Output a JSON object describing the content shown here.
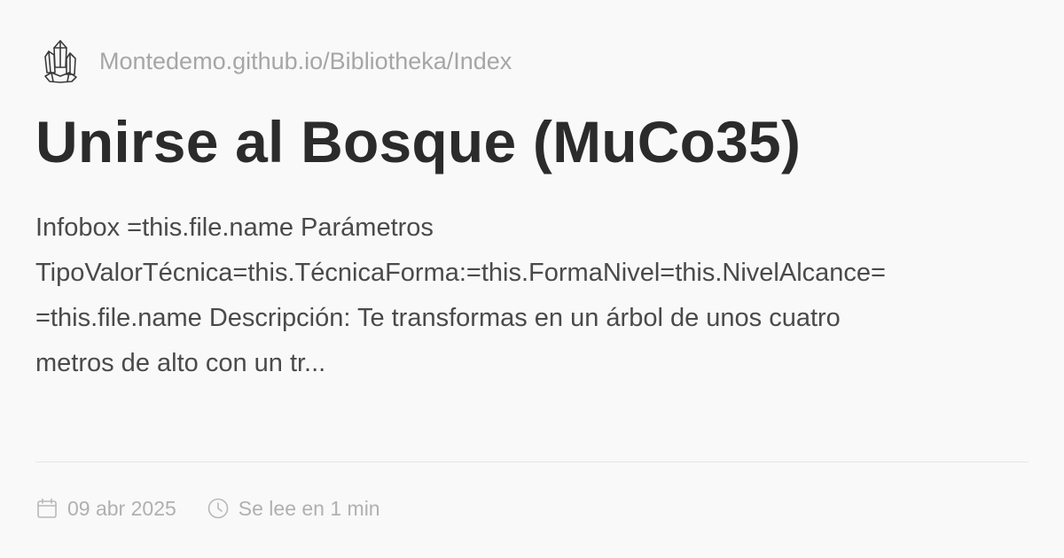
{
  "site": {
    "url": "Montedemo.github.io/Bibliotheka/Index",
    "logo_icon": "crystal-logo-icon"
  },
  "page": {
    "title": "Unirse al Bosque (MuCo35)",
    "description_lines": [
      "Infobox =this.file.name Parámetros",
      "TipoValorTécnica=this.TécnicaForma:=this.FormaNivel=this.NivelAlcance=",
      "=this.file.name Descripción: Te transformas en un árbol de unos cuatro",
      "metros de alto con un tr..."
    ]
  },
  "meta": {
    "date": "09 abr 2025",
    "date_icon": "calendar-icon",
    "read_time": "Se lee en 1 min",
    "read_time_icon": "clock-icon"
  },
  "colors": {
    "background": "#faf9fa",
    "title": "#2b2b2b",
    "body_text": "#4a4a4a",
    "muted": "#a6a6a6",
    "divider": "#e6e4e6"
  }
}
